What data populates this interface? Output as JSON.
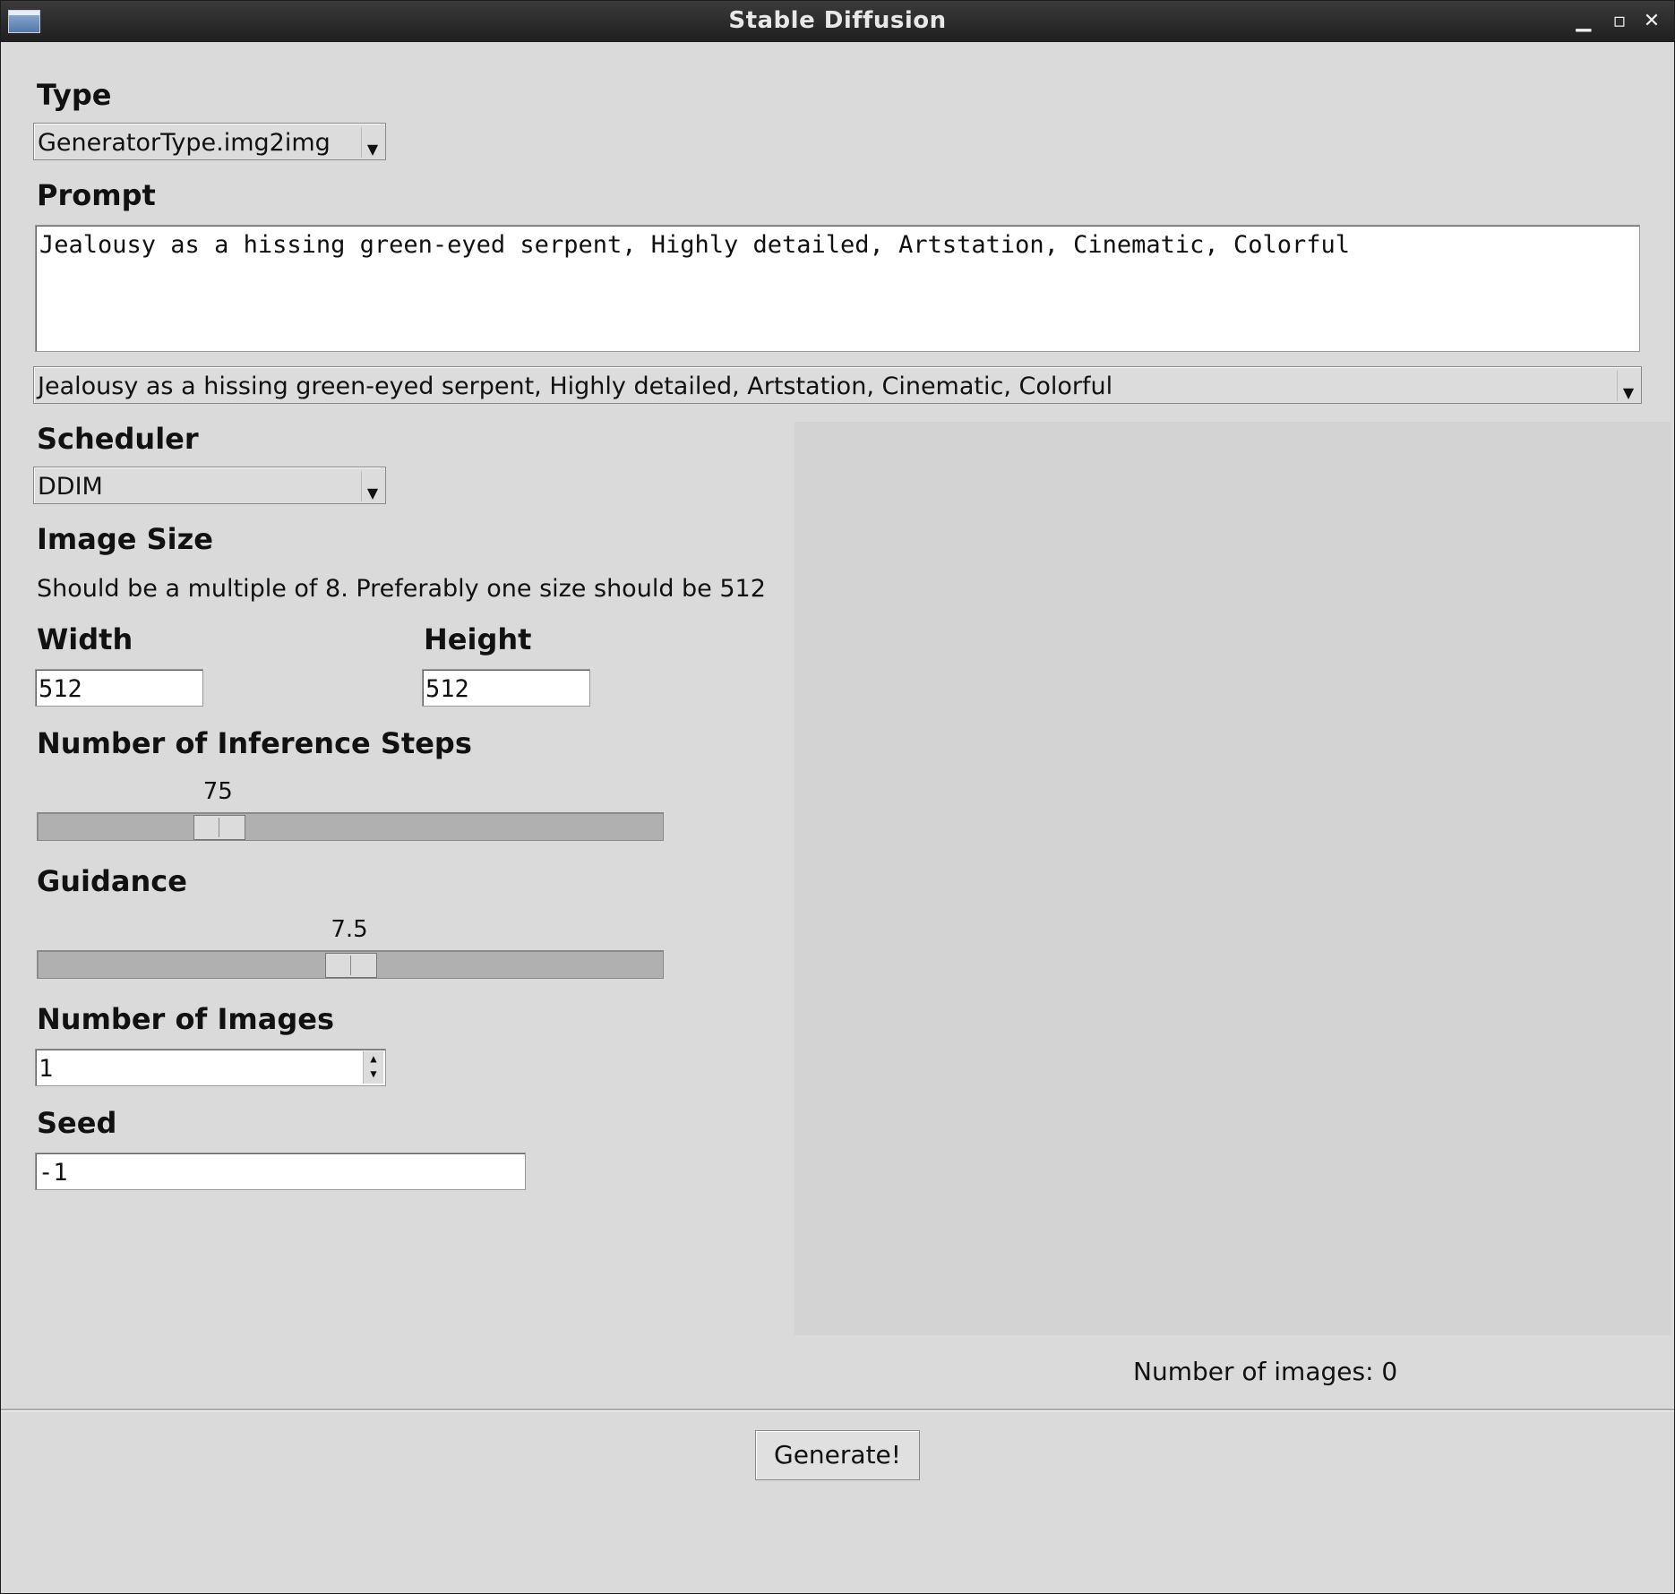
{
  "window": {
    "title": "Stable Diffusion"
  },
  "type": {
    "label": "Type",
    "value": "GeneratorType.img2img"
  },
  "prompt": {
    "label": "Prompt",
    "text": "Jealousy as a hissing green-eyed serpent, Highly detailed, Artstation, Cinematic, Colorful",
    "history_value": "Jealousy as a hissing green-eyed serpent, Highly detailed, Artstation, Cinematic, Colorful"
  },
  "scheduler": {
    "label": "Scheduler",
    "value": "DDIM"
  },
  "image_size": {
    "label": "Image Size",
    "hint": "Should be a multiple of 8. Preferably one size should be 512",
    "width_label": "Width",
    "width_value": "512",
    "height_label": "Height",
    "height_value": "512"
  },
  "inference_steps": {
    "label": "Number of Inference Steps",
    "value": "75",
    "fraction": 0.27
  },
  "guidance": {
    "label": "Guidance",
    "value": "7.5",
    "fraction": 0.5
  },
  "num_images": {
    "label": "Number of Images",
    "value": "1"
  },
  "seed": {
    "label": "Seed",
    "value": "-1"
  },
  "status": {
    "count_text": "Number of images: 0"
  },
  "actions": {
    "generate_label": "Generate!"
  }
}
